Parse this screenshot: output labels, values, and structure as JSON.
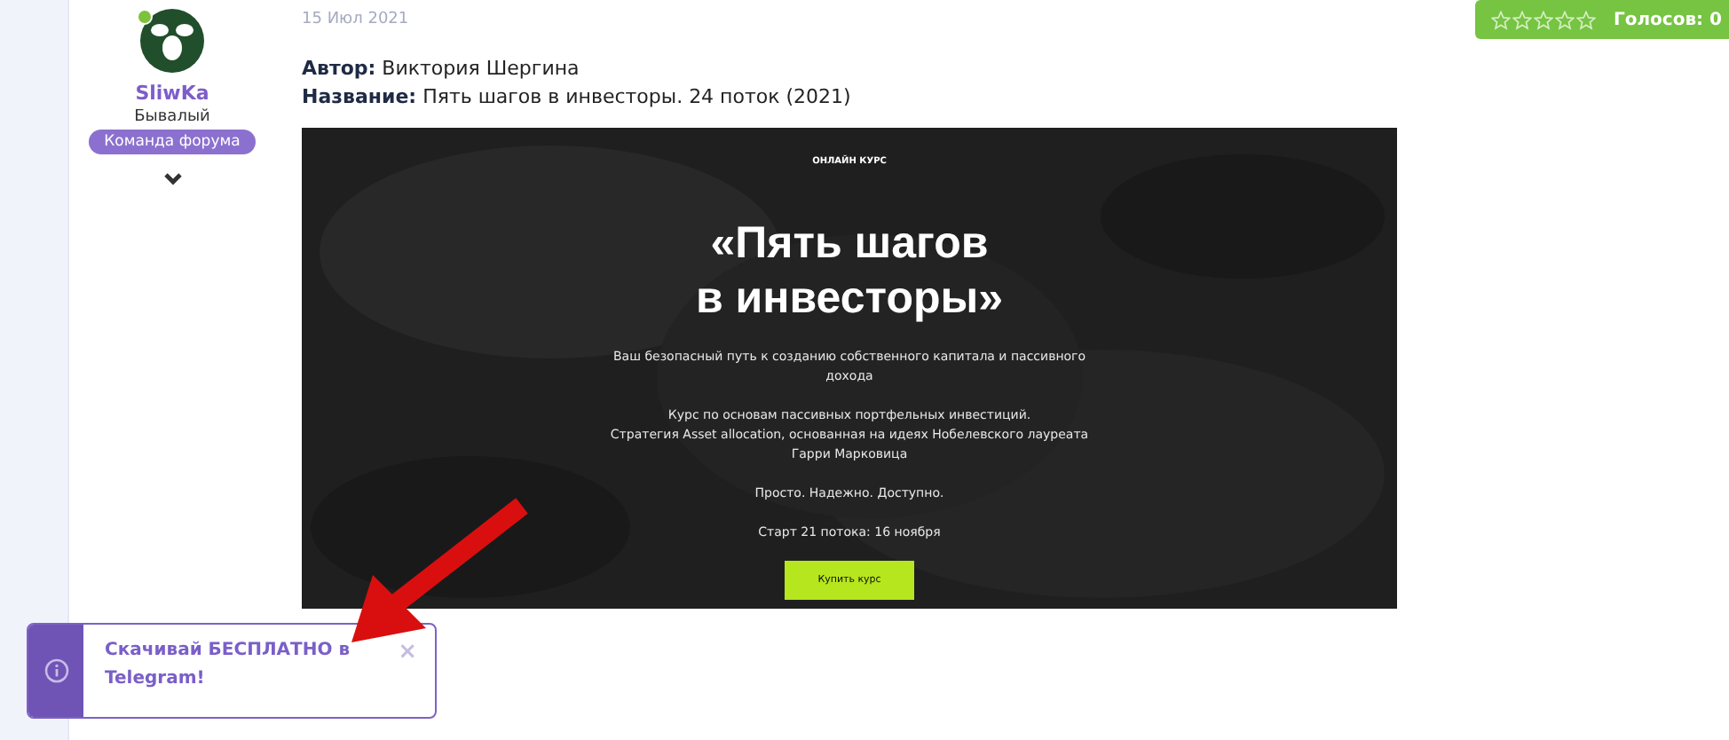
{
  "user": {
    "name": "SliwKa",
    "online": true,
    "rank": "Бывалый",
    "badge": "Команда форума"
  },
  "post": {
    "date": "15 Июл 2021",
    "fields": [
      {
        "label": "Автор:",
        "value": "Виктория Шергина"
      },
      {
        "label": "Название:",
        "value": "Пять шагов в инвесторы. 24 поток (2021)"
      }
    ],
    "promo": {
      "eyebrow": "ОНЛАЙН КУРС",
      "title_lines": [
        "«Пять шагов",
        "в инвесторы»"
      ],
      "paragraphs": [
        [
          "Ваш безопасный путь к созданию собственного капитала и пассивного",
          "дохода"
        ],
        [
          "Курс по основам пассивных портфельных инвестиций.",
          "Стратегия Asset allocation, основанная на идеях Нобелевского лауреата",
          "Гарри Марковица"
        ],
        [
          "Просто. Надежно. Доступно."
        ],
        [
          "Старт 21 потока: 16 ноября"
        ]
      ],
      "button": "Купить курс"
    }
  },
  "rating": {
    "stars": 0,
    "votes": "Голосов: 0"
  },
  "toast": {
    "message": "Скачивай БЕСПЛАТНО в Telegram!",
    "close": "×"
  }
}
